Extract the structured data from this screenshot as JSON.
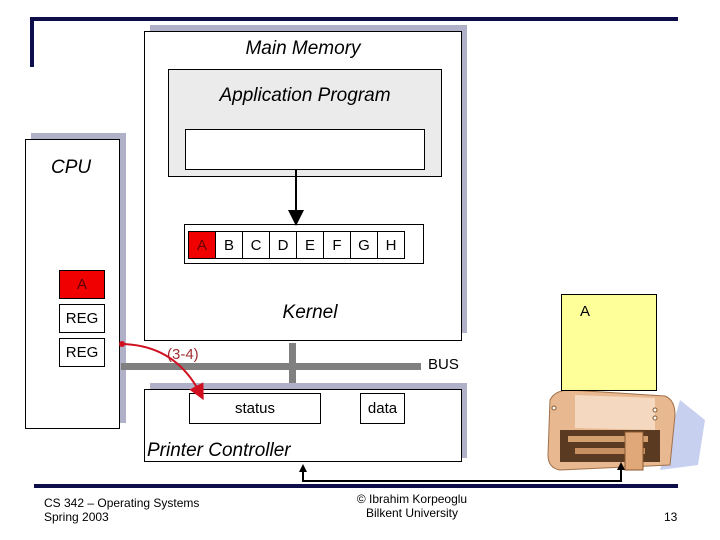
{
  "main_memory": {
    "title": "Main Memory",
    "application_program": "Application Program",
    "kernel_label": "Kernel",
    "buffer_cells": [
      "A",
      "B",
      "C",
      "D",
      "E",
      "F",
      "G",
      "H"
    ],
    "highlighted_cell": "A"
  },
  "cpu": {
    "title": "CPU",
    "registers": [
      "A",
      "REG",
      "REG"
    ],
    "highlighted_register": "A"
  },
  "bus": {
    "label": "BUS",
    "transfer_annotation": "(3-4)"
  },
  "printer_controller": {
    "title": "Printer Controller",
    "status_register": "status",
    "data_register": "data"
  },
  "printer": {
    "paper_content": "A"
  },
  "colors": {
    "highlight": "#f00000",
    "frame": "#0d0d4a",
    "shadow": "#b0b0c8",
    "bus": "#808080",
    "paper": "#ffff99",
    "arrow": "#d01020"
  },
  "footer": {
    "course": "CS 342 – Operating Systems",
    "term": "Spring 2003",
    "author": "© Ibrahim Korpeoglu",
    "institution": "Bilkent University",
    "page_number": "13"
  }
}
